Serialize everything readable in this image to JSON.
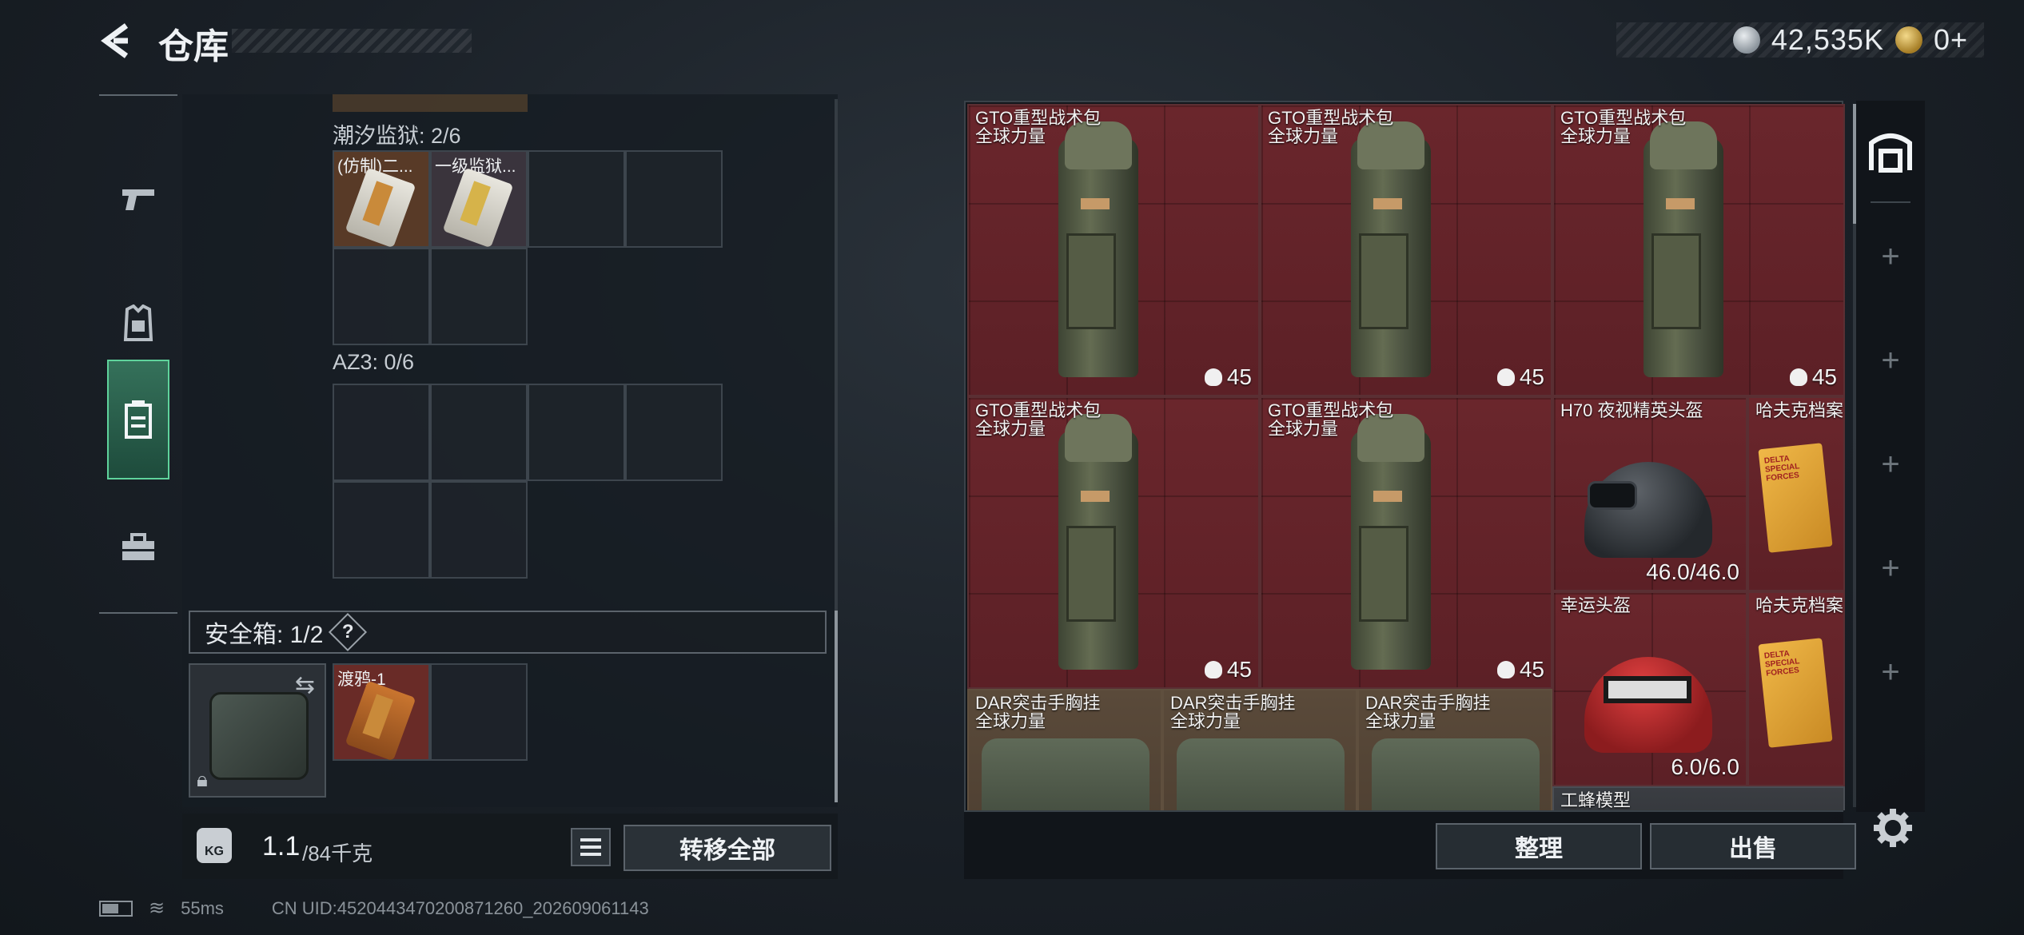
{
  "header": {
    "title": "仓库",
    "currencies": [
      {
        "icon": "silver-coin-icon",
        "value": "42,535K"
      },
      {
        "icon": "gold-coin-icon",
        "value": "0+"
      }
    ]
  },
  "left_nav": {
    "items": [
      {
        "icon": "pistol-icon",
        "glyph": "▰"
      },
      {
        "icon": "armor-icon",
        "glyph": "⛉"
      },
      {
        "icon": "backpack-icon",
        "glyph": "▤"
      },
      {
        "icon": "toolbox-icon",
        "glyph": "⛶"
      }
    ],
    "active_index": 2
  },
  "storage": {
    "sections": [
      {
        "label": "潮汐监狱: 2/6",
        "items": [
          {
            "name": "(仿制)二..."
          },
          {
            "name": "一级监狱..."
          }
        ]
      },
      {
        "label": "AZ3: 0/6",
        "items": []
      }
    ],
    "safe_box": {
      "label": "安全箱: 1/2",
      "help": "?",
      "items": [
        {
          "name": "渡鸦-1"
        }
      ]
    },
    "weight": {
      "current": "1.1",
      "max": "/84千克",
      "icon_label": "KG"
    },
    "transfer_all": "转移全部"
  },
  "backpack": {
    "items": [
      {
        "name": "GTO重型战术包",
        "sub": "全球力量",
        "value": "45"
      },
      {
        "name": "GTO重型战术包",
        "sub": "全球力量",
        "value": "45"
      },
      {
        "name": "GTO重型战术包",
        "sub": "全球力量",
        "value": "45"
      },
      {
        "name": "GTO重型战术包",
        "sub": "全球力量",
        "value": "45"
      },
      {
        "name": "GTO重型战术包",
        "sub": "全球力量",
        "value": "45"
      },
      {
        "name": "H70 夜视精英头盔",
        "value": "46.0/46.0"
      },
      {
        "name": "哈夫克档案"
      },
      {
        "name": "幸运头盔",
        "value": "6.0/6.0"
      },
      {
        "name": "哈夫克档案"
      },
      {
        "name": "DAR突击手胸挂",
        "sub": "全球力量"
      },
      {
        "name": "DAR突击手胸挂",
        "sub": "全球力量"
      },
      {
        "name": "DAR突击手胸挂",
        "sub": "全球力量"
      },
      {
        "name": "工蜂模型"
      }
    ],
    "doc_cover_text": "DELTA SPECIAL FORCES",
    "sort_label": "整理",
    "sell_label": "出售"
  },
  "status_bar": {
    "ping": "55ms",
    "uid": "CN UID:4520443470200871260_202609061143"
  }
}
